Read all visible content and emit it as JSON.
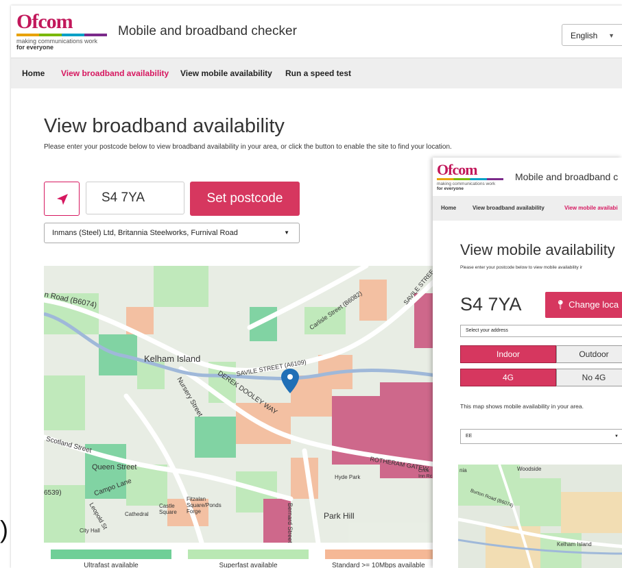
{
  "header": {
    "logo_text": "Ofcom",
    "logo_tagline": "making communications work",
    "logo_tagline2": "for everyone",
    "app_title": "Mobile and broadband checker",
    "language": "English"
  },
  "nav": {
    "items": [
      {
        "label": "Home",
        "active": false
      },
      {
        "label": "View broadband availability",
        "active": true
      },
      {
        "label": "View mobile availability",
        "active": false
      },
      {
        "label": "Run a speed test",
        "active": false
      }
    ]
  },
  "main": {
    "title": "View broadband availability",
    "intro": "Please enter your postcode below to view broadband availability in your area, or click the button to enable the site to find your location.",
    "postcode": "S4 7YA",
    "set_postcode_label": "Set postcode",
    "address": "Inmans (Steel) Ltd, Britannia Steelworks, Furnival Road"
  },
  "map": {
    "labels": {
      "road_b6074": "n Road (B6074)",
      "kelham_island": "Kelham Island",
      "savile_street_a6109": "SAVILE STREET (A6109)",
      "carlisle_street": "Carlisle Street (B6082)",
      "savile_street_ne": "SAVILE STREE",
      "derek_dooley_way": "DEREK DOOLEY WAY",
      "nursery_street": "Nursery Street",
      "scotland_street": "Scotland Street",
      "queen_street": "Queen Street",
      "campo_lane": "Campo Lane",
      "b6539": "6539)",
      "leopold_st": "Leopold St",
      "city_hall": "City Hall",
      "cathedral": "Cathedral",
      "castle_square": "Castle Square",
      "fitzalan_square": "Fitzalan Square/Ponds Forge",
      "rotherham_gateway": "ROTHERAM GATEW",
      "hyde_park": "Hyde Park",
      "crick_inn": "Crick Inn Rc",
      "bernard_street": "Bernard Street (B6",
      "park_hill": "Park Hill"
    }
  },
  "legend": [
    {
      "label": "Ultrafast available",
      "color": "#6fcf97"
    },
    {
      "label": "Superfast available",
      "color": "#b9e8b3"
    },
    {
      "label": "Standard >= 10Mbps available",
      "color": "#f5b896"
    }
  ],
  "inset": {
    "logo_text": "Ofcom",
    "logo_tagline": "making communications work",
    "logo_tagline2": "for everyone",
    "app_title": "Mobile and broadband c",
    "nav": [
      {
        "label": "Home",
        "active": false
      },
      {
        "label": "View broadband availability",
        "active": false
      },
      {
        "label": "View mobile availabi",
        "active": true
      }
    ],
    "title": "View mobile availability",
    "intro": "Please enter your postcode below to view mobile availability ir",
    "postcode": "S4 7YA",
    "change_label": "Change loca",
    "address_placeholder": "Select your address",
    "toggle_indoor": "Indoor",
    "toggle_outdoor": "Outdoor",
    "toggle_4g": "4G",
    "toggle_no4g": "No 4G",
    "map_info": "This map shows mobile availability in your area.",
    "network": "EE",
    "map_labels": {
      "nia": "nia",
      "woodside": "Woodside",
      "burton_road": "Burton Road (B6074)",
      "kelham_island": "Kelham Island"
    }
  },
  "colors": {
    "accent": "#d6175f",
    "button": "#d6375f",
    "ultrafast": "#6fcf97",
    "superfast": "#b9e8b3",
    "standard": "#f5b896",
    "poor": "#c9517b"
  }
}
